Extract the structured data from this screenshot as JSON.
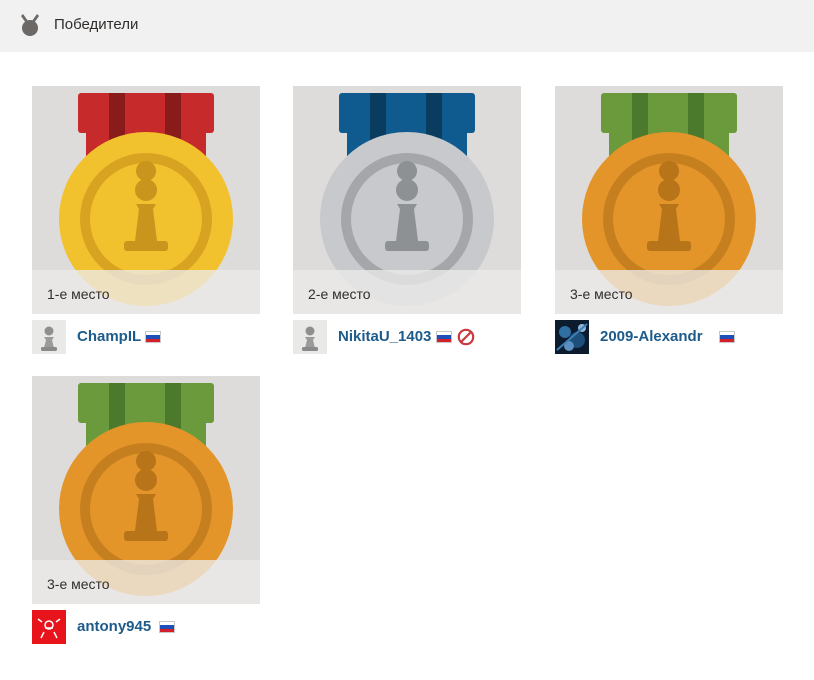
{
  "header": {
    "title": "Победители",
    "icon": "medal-icon"
  },
  "winners": [
    {
      "place": "1-е место",
      "username": "ChampIL",
      "flag": "russia-flag",
      "banned": false,
      "colors": {
        "ribbon": "#c62a2a",
        "ribbon_stripe": "#8a1b1b",
        "medal": "#f2c12e",
        "medal_inner": "#d9a322",
        "pawn": "#c9951d"
      }
    },
    {
      "place": "2-е место",
      "username": "NikitaU_1403",
      "flag": "russia-flag",
      "banned": true,
      "colors": {
        "ribbon": "#0f5b8f",
        "ribbon_stripe": "#0a3c60",
        "medal": "#c7c9cc",
        "medal_inner": "#a4a6a9",
        "pawn": "#8e9194"
      }
    },
    {
      "place": "3-е место",
      "username": "2009-Alexandr",
      "flag": "russia-flag",
      "banned": false,
      "colors": {
        "ribbon": "#6a9a3c",
        "ribbon_stripe": "#4b7a2c",
        "medal": "#e3952a",
        "medal_inner": "#c67f1f",
        "pawn": "#b87418"
      }
    },
    {
      "place": "3-е место",
      "username": "antony945",
      "flag": "russia-flag",
      "banned": false,
      "colors": {
        "ribbon": "#6a9a3c",
        "ribbon_stripe": "#4b7a2c",
        "medal": "#e3952a",
        "medal_inner": "#c67f1f",
        "pawn": "#b87418"
      }
    }
  ]
}
